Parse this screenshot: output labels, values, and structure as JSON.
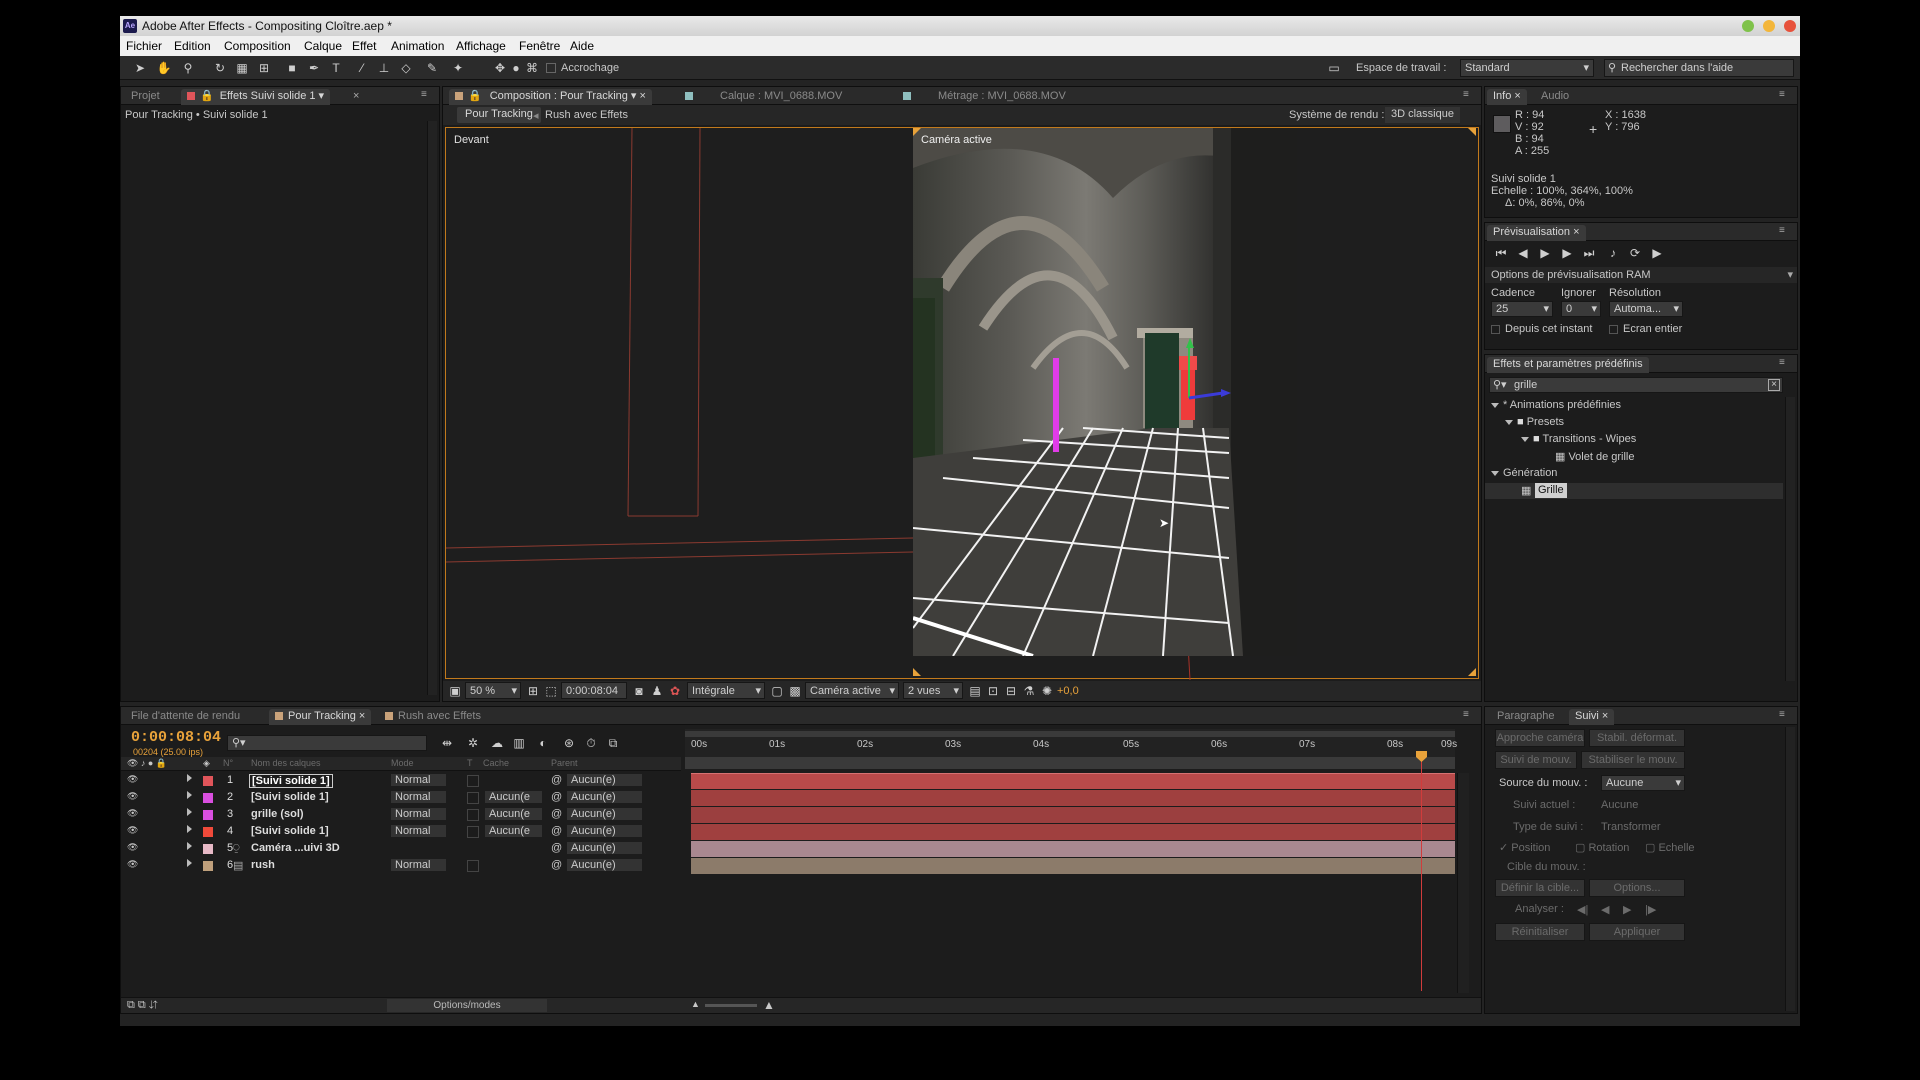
{
  "window": {
    "title": "Adobe After Effects - Compositing Cloître.aep *",
    "app_badge": "Ae"
  },
  "menu": [
    "Fichier",
    "Edition",
    "Composition",
    "Calque",
    "Effet",
    "Animation",
    "Affichage",
    "Fenêtre",
    "Aide"
  ],
  "toolbar": {
    "snap_label": "Accrochage",
    "workspace_label": "Espace de travail :",
    "workspace_value": "Standard",
    "help_placeholder": "Rechercher dans l'aide"
  },
  "left_panel": {
    "tab_project": "Projet",
    "tab_effects": "Effets Suivi solide 1",
    "breadcrumb": "Pour Tracking • Suivi solide 1"
  },
  "comp_panel": {
    "tab_comp": "Composition : Pour Tracking",
    "tab_layer": "Calque : MVI_0688.MOV",
    "tab_footage": "Métrage : MVI_0688.MOV",
    "sub_active": "Pour Tracking",
    "sub_other": "Rush avec Effets",
    "renderer_label": "Système de rendu :",
    "renderer_value": "3D classique",
    "view_left": "Devant",
    "view_right": "Caméra active",
    "bottom": {
      "zoom": "50 %",
      "timecode": "0:00:08:04",
      "quality": "Intégrale",
      "camera": "Caméra active",
      "views": "2 vues",
      "exposure": "+0,0"
    }
  },
  "info_panel": {
    "tab_info": "Info",
    "tab_audio": "Audio",
    "r": "R : 94",
    "v": "V : 92",
    "b": "B : 94",
    "a": "A : 255",
    "x": "X : 1638",
    "y": "Y : 796",
    "layer": "Suivi solide 1",
    "scale": "Echelle : 100%, 364%, 100%",
    "delta": "Δ: 0%, 86%, 0%"
  },
  "preview_panel": {
    "tab": "Prévisualisation",
    "ram_options": "Options de prévisualisation RAM",
    "cadence_label": "Cadence",
    "ignore_label": "Ignorer",
    "resolution_label": "Résolution",
    "cadence_value": "25",
    "ignore_value": "0",
    "resolution_value": "Automa...",
    "from_current": "Depuis cet instant",
    "fullscreen": "Ecran entier"
  },
  "effects_panel": {
    "tab": "Effets et paramètres prédéfinis",
    "search_value": "grille",
    "tree": [
      "* Animations prédéfinies",
      "Presets",
      "Transitions - Wipes",
      "Volet de grille",
      "Génération",
      "Grille"
    ]
  },
  "timeline": {
    "tabs": [
      "File d'attente de rendu",
      "Pour Tracking",
      "Rush avec Effets"
    ],
    "timecode": "0:00:08:04",
    "frames": "00204 (25.00 ips)",
    "headers": {
      "num": "N°",
      "name": "Nom des calques",
      "mode": "Mode",
      "t": "T",
      "cache": "Cache",
      "parent": "Parent"
    },
    "ruler": [
      "00s",
      "01s",
      "02s",
      "03s",
      "04s",
      "05s",
      "06s",
      "07s",
      "08s",
      "09s"
    ],
    "layers": [
      {
        "num": "1",
        "name": "[Suivi solide 1]",
        "mode": "Normal",
        "cache": "",
        "parent": "Aucun(e)",
        "color": "#e0555a"
      },
      {
        "num": "2",
        "name": "[Suivi solide 1]",
        "mode": "Normal",
        "cache": "Aucun(e",
        "parent": "Aucun(e)",
        "color": "#d94fe0"
      },
      {
        "num": "3",
        "name": "grille (sol)",
        "mode": "Normal",
        "cache": "Aucun(e",
        "parent": "Aucun(e)",
        "color": "#d94fe0"
      },
      {
        "num": "4",
        "name": "[Suivi solide 1]",
        "mode": "Normal",
        "cache": "Aucun(e",
        "parent": "Aucun(e)",
        "color": "#f04a3a"
      },
      {
        "num": "5",
        "name": "Caméra ...uivi 3D",
        "mode": "",
        "cache": "",
        "parent": "Aucun(e)",
        "color": "#e7b9c6"
      },
      {
        "num": "6",
        "name": "rush",
        "mode": "Normal",
        "cache": "",
        "parent": "Aucun(e)",
        "color": "#bfa07c"
      }
    ],
    "options_label": "Options/modes"
  },
  "tracker_panel": {
    "tab_paragraph": "Paragraphe",
    "tab_track": "Suivi",
    "camera_track": "Approche caméra",
    "warp_stab": "Stabil. déformat.",
    "track_motion": "Suivi de mouv.",
    "stabilize": "Stabiliser le mouv.",
    "source_label": "Source du mouv. :",
    "source_value": "Aucune",
    "current_label": "Suivi actuel :",
    "current_value": "Aucune",
    "type_label": "Type de suivi :",
    "type_value": "Transformer",
    "position": "Position",
    "rotation": "Rotation",
    "scale": "Echelle",
    "target": "Cible du mouv. :",
    "define_target": "Définir la cible...",
    "options": "Options...",
    "analyze": "Analyser :",
    "reset": "Réinitialiser",
    "apply": "Appliquer"
  },
  "colors": {
    "accent_orange": "#e8a23a",
    "playhead": "#d03c3c",
    "timecode": "#e8a23a"
  }
}
